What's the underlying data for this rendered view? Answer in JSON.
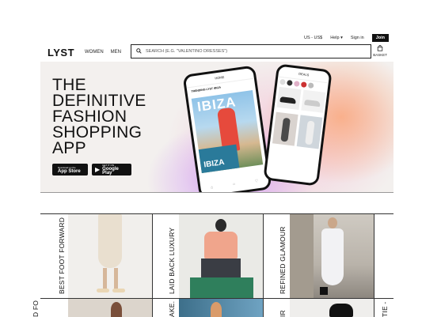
{
  "util": {
    "region": "US - US$",
    "help": "Help",
    "signin": "Sign in",
    "join": "Join"
  },
  "header": {
    "logo": "LYST",
    "nav": [
      "WOMEN",
      "MEN"
    ],
    "search_placeholder": "SEARCH (E.G. \"VALENTINO DRESSES\")",
    "basket": "BASKET"
  },
  "hero": {
    "title_lines": [
      "THE",
      "DEFINITIVE",
      "FASHION",
      "SHOPPING",
      "APP"
    ],
    "app_store": {
      "small": "Download on the",
      "big": "App Store"
    },
    "google_play": {
      "small": "GET IT ON",
      "big": "Google Play"
    },
    "phone1": {
      "header": "HOME",
      "section": "TRENDING LYST IBIZA",
      "big_text": "IBIZA"
    },
    "phone2": {
      "header": "DEALS"
    }
  },
  "tiles": [
    {
      "label": "BEST FOOT FORWARD"
    },
    {
      "label": "LAID BACK LUXURY"
    },
    {
      "label": "REFINED GLAMOUR"
    }
  ],
  "tiles_row2": [
    {
      "label": "D FOR"
    },
    {
      "label": "AKE."
    },
    {
      "label": "IR"
    },
    {
      "label": "TIE -"
    }
  ],
  "colors": {
    "accent": "#111111",
    "hero_purple": "#d6a4f2",
    "hero_orange": "#f9b08c"
  }
}
